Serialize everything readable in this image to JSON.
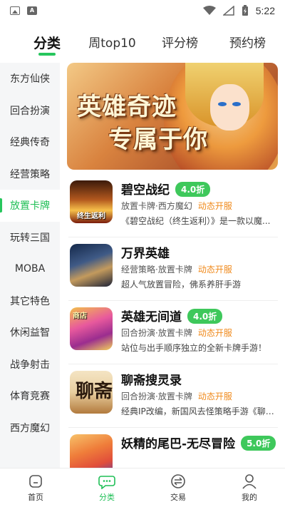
{
  "status_bar": {
    "time": "5:22",
    "icons": [
      "gallery-icon",
      "text-icon",
      "wifi-icon",
      "signal-icon",
      "battery-icon"
    ]
  },
  "tabs": [
    {
      "label": "分类",
      "active": true
    },
    {
      "label": "周top10",
      "active": false
    },
    {
      "label": "评分榜",
      "active": false
    },
    {
      "label": "预约榜",
      "active": false
    }
  ],
  "sidebar": {
    "items": [
      {
        "label": "东方仙侠",
        "active": false
      },
      {
        "label": "回合扮演",
        "active": false
      },
      {
        "label": "经典传奇",
        "active": false
      },
      {
        "label": "经营策略",
        "active": false
      },
      {
        "label": "放置卡牌",
        "active": true
      },
      {
        "label": "玩转三国",
        "active": false
      },
      {
        "label": "MOBA",
        "active": false
      },
      {
        "label": "其它特色",
        "active": false
      },
      {
        "label": "休闲益智",
        "active": false
      },
      {
        "label": "战争射击",
        "active": false
      },
      {
        "label": "体育竞赛",
        "active": false
      },
      {
        "label": "西方魔幻",
        "active": false
      }
    ]
  },
  "banner": {
    "line1": "英雄奇迹",
    "line2": "专属于你"
  },
  "games": [
    {
      "name": "碧空战纪",
      "discount": "4.0折",
      "tags": "放置卡牌·西方魔幻",
      "status": "动态开服",
      "desc": "《碧空战纪（终生返利）》是一款以魔...",
      "icon_text": "终生返利"
    },
    {
      "name": "万界英雄",
      "discount": "",
      "tags": "经营策略·放置卡牌",
      "status": "动态开服",
      "desc": "超人气放置冒险，佛系养肝手游",
      "icon_text": ""
    },
    {
      "name": "英雄无间道",
      "discount": "4.0折",
      "tags": "回合扮演·放置卡牌",
      "status": "动态开服",
      "desc": "站位与出手顺序独立的全新卡牌手游！",
      "icon_text": "商店"
    },
    {
      "name": "聊斋搜灵录",
      "discount": "",
      "tags": "回合扮演·放置卡牌",
      "status": "动态开服",
      "desc": "经典IP改编，新国风去怪策略手游《聊斋...",
      "icon_text": "聊斋"
    },
    {
      "name": "妖精的尾巴-无尽冒险",
      "discount": "5.0折",
      "tags": "",
      "status": "",
      "desc": "",
      "icon_text": ""
    }
  ],
  "bottom_nav": [
    {
      "label": "首页",
      "icon": "home-icon",
      "active": false
    },
    {
      "label": "分类",
      "icon": "category-icon",
      "active": true
    },
    {
      "label": "交易",
      "icon": "trade-icon",
      "active": false
    },
    {
      "label": "我的",
      "icon": "profile-icon",
      "active": false
    }
  ],
  "colors": {
    "accent": "#27c65d",
    "discount_badge": "#3ec85b",
    "status_orange": "#f08a1c",
    "sidebar_bg": "#f5f6f7"
  }
}
